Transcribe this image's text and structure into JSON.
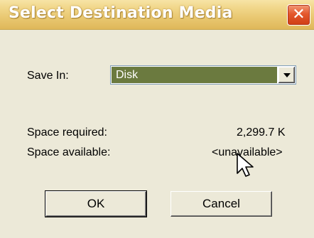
{
  "window": {
    "title": "Select Destination Media",
    "close_symbol": "✕"
  },
  "form": {
    "save_in_label": "Save In:",
    "save_in_value": "Disk",
    "space_required_label": "Space required:",
    "space_required_value": "2,299.7 K",
    "space_available_label": "Space available:",
    "space_available_value": "<unavailable>"
  },
  "buttons": {
    "ok_label": "OK",
    "cancel_label": "Cancel"
  },
  "icons": {
    "dropdown": "chevron-down-icon",
    "cursor": "mouse-pointer-icon",
    "close": "close-icon"
  },
  "colors": {
    "title_bar": "#e9c871",
    "dialog_background": "#ece9d8",
    "selection_highlight": "#6b7a3f",
    "close_button": "#e4582d"
  }
}
